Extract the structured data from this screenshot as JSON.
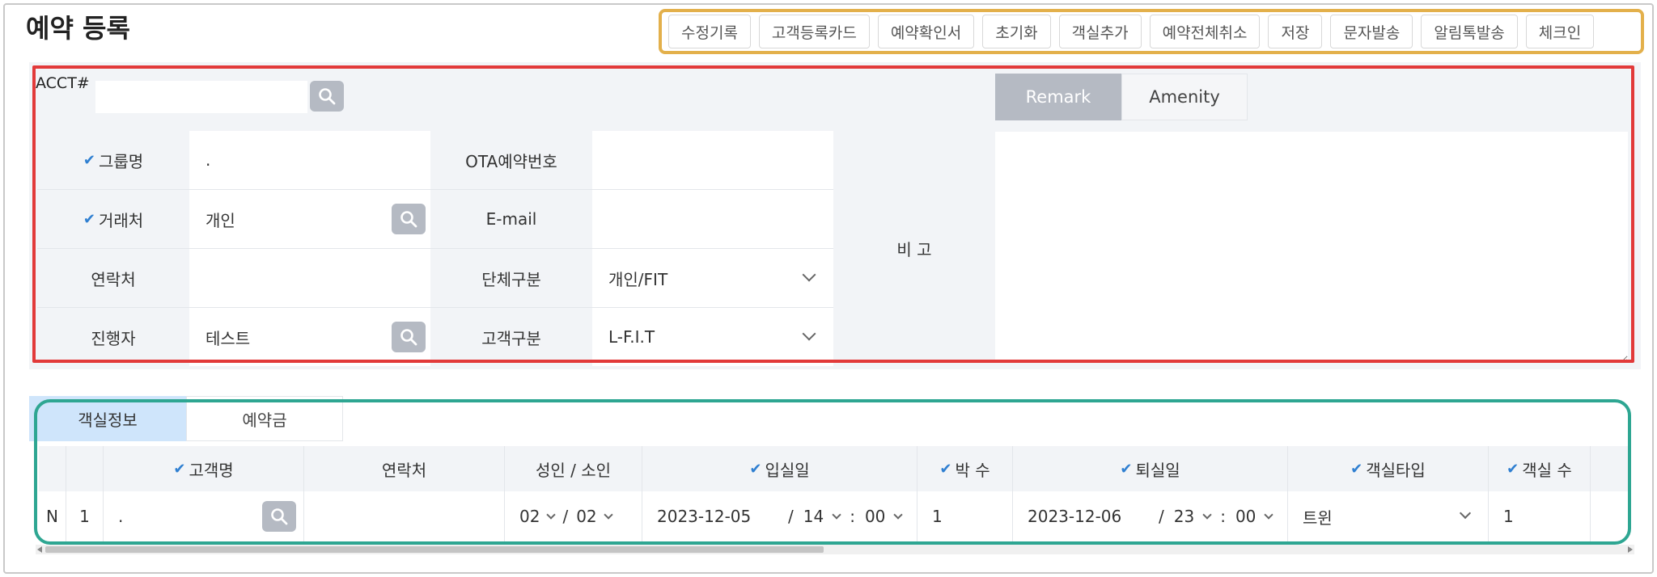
{
  "page": {
    "title": "예약 등록"
  },
  "toolbar": {
    "buttons": [
      "수정기록",
      "고객등록카드",
      "예약확인서",
      "초기화",
      "객실추가",
      "예약전체취소",
      "저장",
      "문자발송",
      "알림톡발송",
      "체크인"
    ]
  },
  "acct": {
    "label": "ACCT#",
    "value": ""
  },
  "form": {
    "group_name": {
      "label": "그룹명",
      "value": "."
    },
    "client": {
      "label": "거래처",
      "value": "개인"
    },
    "contact": {
      "label": "연락처",
      "value": ""
    },
    "handler": {
      "label": "진행자",
      "value": "테스트"
    },
    "ota_no": {
      "label": "OTA예약번호",
      "value": ""
    },
    "email": {
      "label": "E-mail",
      "value": ""
    },
    "group_type": {
      "label": "단체구분",
      "value": "개인/FIT"
    },
    "customer_type": {
      "label": "고객구분",
      "value": "L-F.I.T"
    },
    "remark_label": "비 고"
  },
  "remark_tabs": [
    "Remark",
    "Amenity"
  ],
  "remark_text": "",
  "bottom_tabs": [
    "객실정보",
    "예약금"
  ],
  "room_table": {
    "headers": [
      "고객명",
      "연락처",
      "성인 / 소인",
      "입실일",
      "박 수",
      "퇴실일",
      "객실타입",
      "객실 수"
    ],
    "row": {
      "flag": "N",
      "no": "1",
      "guest": ".",
      "phone": "",
      "adult": "02",
      "sep": "/",
      "child": "02",
      "checkin_date": "2023-12-05",
      "checkin_hour": "14",
      "checkin_min": "00",
      "nights": "1",
      "checkout_date": "2023-12-06",
      "checkout_hour": "23",
      "checkout_min": "00",
      "time_sep": ":",
      "room_type": "트윈",
      "room_count": "1"
    }
  },
  "colors": {
    "toolbar_outline": "#e3b04b",
    "form_outline": "#e23a3a",
    "table_outline": "#2ea692",
    "active_tab": "#b5bac3",
    "active_room_tab": "#cfe5fb",
    "required_check": "#2f7fd1"
  }
}
